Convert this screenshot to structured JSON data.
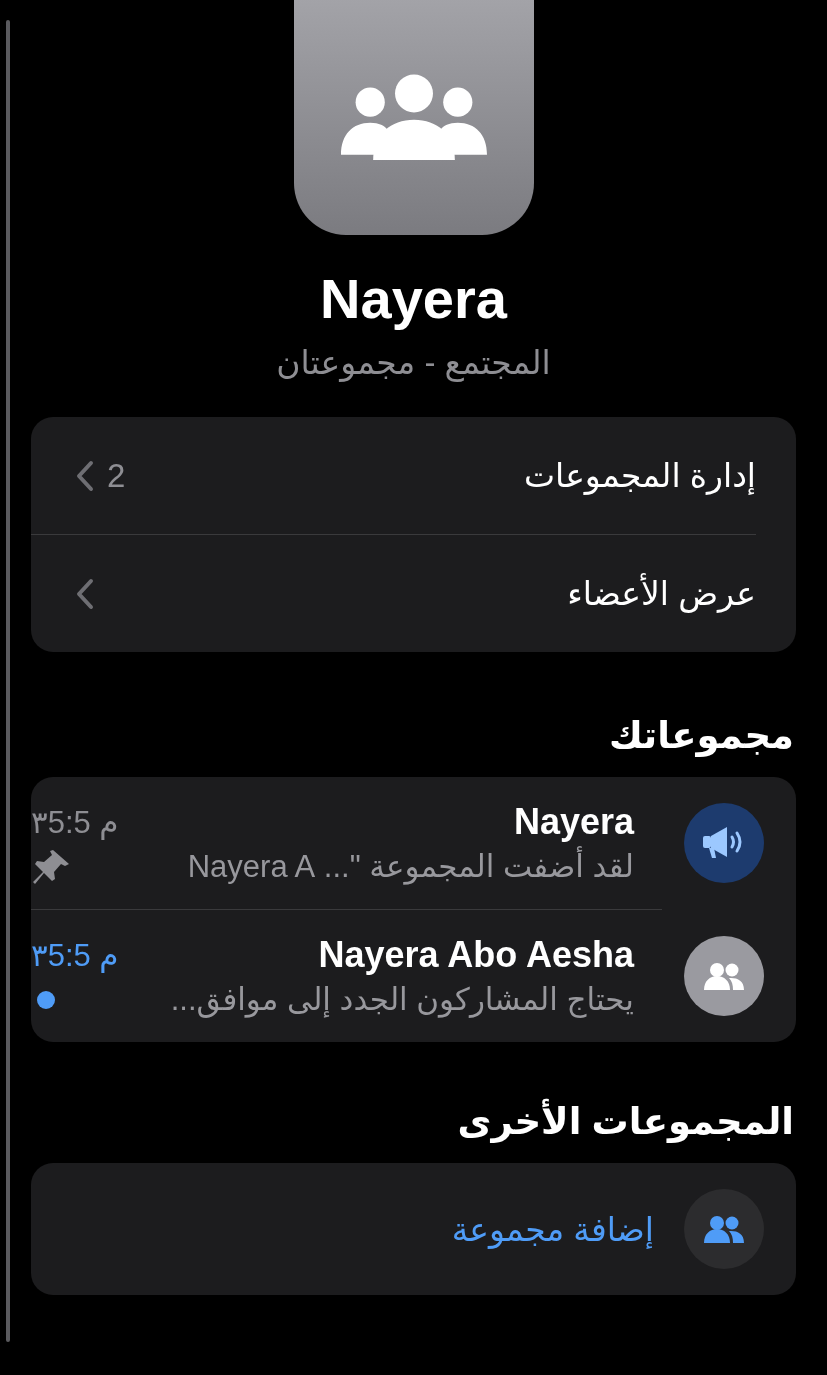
{
  "community": {
    "name": "Nayera",
    "subtitle": "المجتمع - مجموعتان"
  },
  "menu": [
    {
      "label": "إدارة المجموعات",
      "count": "2"
    },
    {
      "label": "عرض الأعضاء"
    }
  ],
  "your_groups": {
    "title": "مجموعاتك",
    "items": [
      {
        "kind": "announcement",
        "name": "Nayera",
        "time": "٣5:5 م",
        "preview": "لقد أضفت المجموعة \"... Nayera A",
        "pinned": true,
        "unread": false
      },
      {
        "kind": "group",
        "name": "Nayera Abo Aesha",
        "time": "٣5:5 م",
        "preview": "يحتاج المشاركون الجدد إلى موافق...",
        "pinned": false,
        "unread": true
      }
    ]
  },
  "other_groups": {
    "title": "المجموعات الأخرى",
    "action": "إضافة مجموعة"
  }
}
